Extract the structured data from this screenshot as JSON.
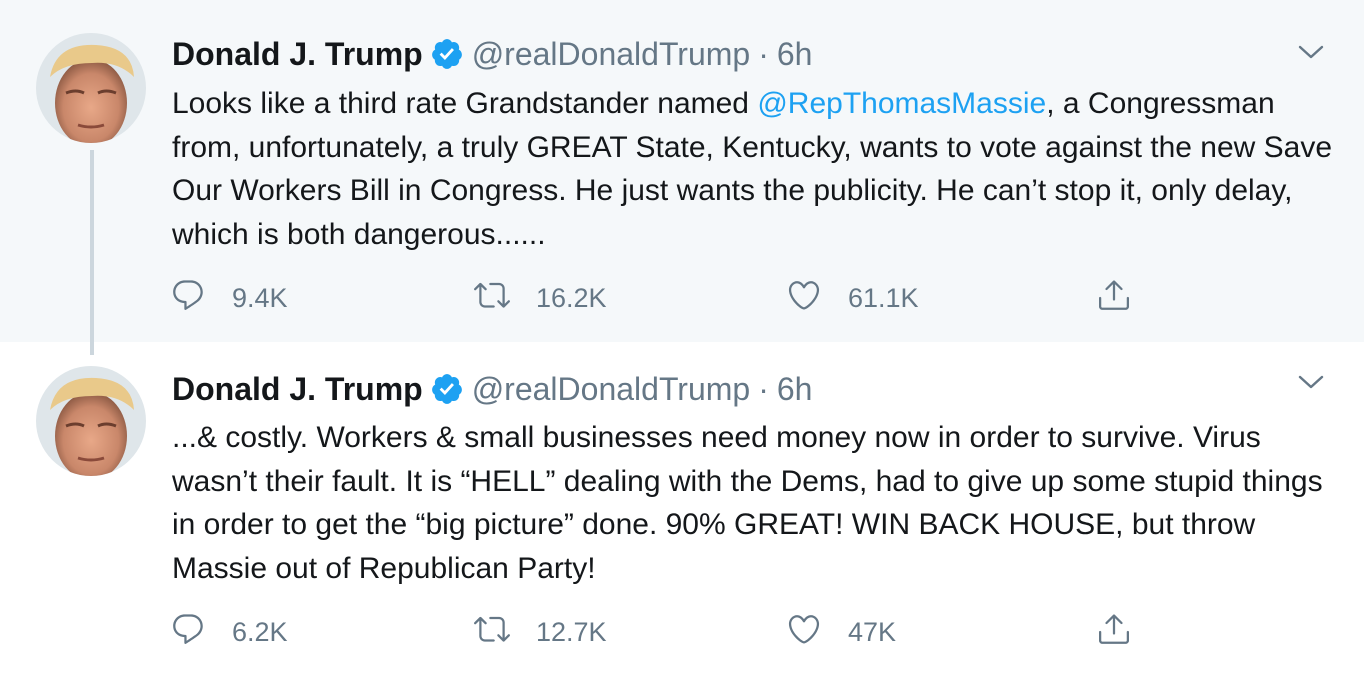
{
  "tweets": [
    {
      "author": "Donald J. Trump",
      "handle": "@realDonaldTrump",
      "separator": "·",
      "time": "6h",
      "text_before": "Looks like a third rate Grandstander named ",
      "mention": "@RepThomasMassie",
      "text_after": ", a Congressman from, unfortunately, a truly GREAT State, Kentucky, wants to vote against the new Save Our Workers Bill in Congress. He just wants the publicity. He can’t stop it, only delay, which is both dangerous......",
      "replies": "9.4K",
      "retweets": "16.2K",
      "likes": "61.1K"
    },
    {
      "author": "Donald J. Trump",
      "handle": "@realDonaldTrump",
      "separator": "·",
      "time": "6h",
      "text": "...& costly. Workers & small businesses need money now in order to survive. Virus wasn’t their fault. It is “HELL” dealing with the Dems, had to give up some stupid things in order to get the “big picture” done. 90% GREAT! WIN BACK HOUSE, but throw Massie out of Republican Party!",
      "replies": "6.2K",
      "retweets": "12.7K",
      "likes": "47K"
    }
  ],
  "colors": {
    "accent": "#1da1f2",
    "text": "#14171a",
    "secondary": "#657786",
    "highlight_bg": "#f5f8fa",
    "thread_line": "#ccd6dd"
  },
  "icons": [
    "avatar-photo",
    "verified-badge-icon",
    "chevron-down-icon",
    "reply-icon",
    "retweet-icon",
    "like-icon",
    "share-icon"
  ]
}
